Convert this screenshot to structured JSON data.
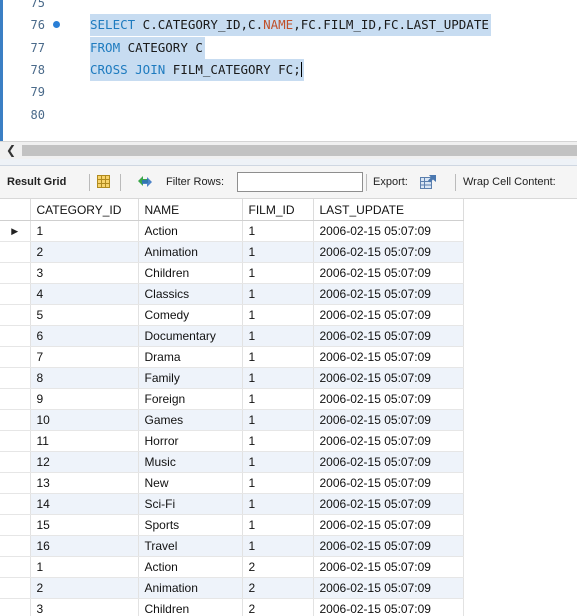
{
  "editor": {
    "lines": [
      {
        "num": "75",
        "has_bullet": false,
        "parts": []
      },
      {
        "num": "76",
        "has_bullet": true,
        "parts": [
          {
            "t": "SELECT",
            "cls": "kw"
          },
          {
            "t": " C.CATEGORY_ID,C.",
            "cls": ""
          },
          {
            "t": "NAME",
            "cls": "fn"
          },
          {
            "t": ",FC.FILM_ID,FC.LAST_UPDATE",
            "cls": ""
          }
        ]
      },
      {
        "num": "77",
        "has_bullet": false,
        "parts": [
          {
            "t": "FROM",
            "cls": "kw"
          },
          {
            "t": " CATEGORY C",
            "cls": ""
          }
        ]
      },
      {
        "num": "78",
        "has_bullet": false,
        "cursor": true,
        "parts": [
          {
            "t": "CROSS JOIN",
            "cls": "kw"
          },
          {
            "t": " FILM_CATEGORY FC;",
            "cls": ""
          }
        ]
      },
      {
        "num": "79",
        "has_bullet": false,
        "parts": []
      },
      {
        "num": "80",
        "has_bullet": false,
        "parts": []
      }
    ]
  },
  "toolbar": {
    "result_grid": "Result Grid",
    "filter_rows": "Filter Rows:",
    "filter_value": "",
    "export": "Export:",
    "wrap": "Wrap Cell Content:",
    "grid_icon": "grid-layout-icon",
    "filter_icon": "refresh-filter-icon",
    "export_icon": "export-grid-icon"
  },
  "grid": {
    "columns": [
      "CATEGORY_ID",
      "NAME",
      "FILM_ID",
      "LAST_UPDATE"
    ],
    "rows": [
      [
        "1",
        "Action",
        "1",
        "2006-02-15 05:07:09"
      ],
      [
        "2",
        "Animation",
        "1",
        "2006-02-15 05:07:09"
      ],
      [
        "3",
        "Children",
        "1",
        "2006-02-15 05:07:09"
      ],
      [
        "4",
        "Classics",
        "1",
        "2006-02-15 05:07:09"
      ],
      [
        "5",
        "Comedy",
        "1",
        "2006-02-15 05:07:09"
      ],
      [
        "6",
        "Documentary",
        "1",
        "2006-02-15 05:07:09"
      ],
      [
        "7",
        "Drama",
        "1",
        "2006-02-15 05:07:09"
      ],
      [
        "8",
        "Family",
        "1",
        "2006-02-15 05:07:09"
      ],
      [
        "9",
        "Foreign",
        "1",
        "2006-02-15 05:07:09"
      ],
      [
        "10",
        "Games",
        "1",
        "2006-02-15 05:07:09"
      ],
      [
        "11",
        "Horror",
        "1",
        "2006-02-15 05:07:09"
      ],
      [
        "12",
        "Music",
        "1",
        "2006-02-15 05:07:09"
      ],
      [
        "13",
        "New",
        "1",
        "2006-02-15 05:07:09"
      ],
      [
        "14",
        "Sci-Fi",
        "1",
        "2006-02-15 05:07:09"
      ],
      [
        "15",
        "Sports",
        "1",
        "2006-02-15 05:07:09"
      ],
      [
        "16",
        "Travel",
        "1",
        "2006-02-15 05:07:09"
      ],
      [
        "1",
        "Action",
        "2",
        "2006-02-15 05:07:09"
      ],
      [
        "2",
        "Animation",
        "2",
        "2006-02-15 05:07:09"
      ],
      [
        "3",
        "Children",
        "2",
        "2006-02-15 05:07:09"
      ]
    ],
    "current_row_marker": "▶",
    "selected_row": 0
  }
}
